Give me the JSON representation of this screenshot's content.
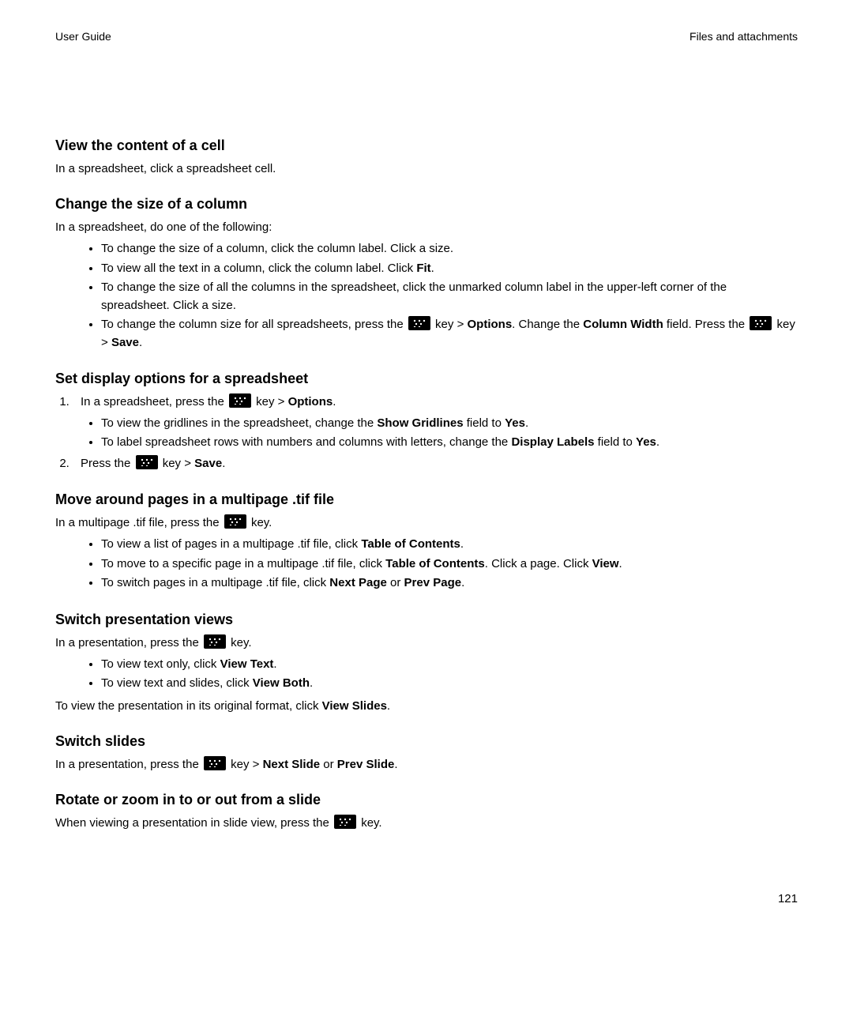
{
  "header": {
    "left": "User Guide",
    "right": "Files and attachments"
  },
  "page_number": "121",
  "sections": {
    "view_cell": {
      "title": "View the content of a cell",
      "p1": "In a spreadsheet, click a spreadsheet cell."
    },
    "change_col": {
      "title": "Change the size of a column",
      "intro": "In a spreadsheet, do one of the following:",
      "b1": "To change the size of a column, click the column label. Click a size.",
      "b2a": "To view all the text in a column, click the column label. Click ",
      "b2b": "Fit",
      "b2c": ".",
      "b3": "To change the size of all the columns in the spreadsheet, click the unmarked column label in the upper-left corner of the spreadsheet. Click a size.",
      "b4a": "To change the column size for all spreadsheets, press the ",
      "b4b": " key > ",
      "b4c": "Options",
      "b4d": ". Change the ",
      "b4e": "Column Width",
      "b4f": " field. Press the ",
      "b4g": " key > ",
      "b4h": "Save",
      "b4i": "."
    },
    "display_opts": {
      "title": "Set display options for a spreadsheet",
      "s1a": "In a spreadsheet, press the ",
      "s1b": " key > ",
      "s1c": "Options",
      "s1d": ".",
      "s1_b1a": "To view the gridlines in the spreadsheet, change the ",
      "s1_b1b": "Show Gridlines",
      "s1_b1c": " field to ",
      "s1_b1d": "Yes",
      "s1_b1e": ".",
      "s1_b2a": "To label spreadsheet rows with numbers and columns with letters, change the ",
      "s1_b2b": "Display Labels",
      "s1_b2c": " field to ",
      "s1_b2d": "Yes",
      "s1_b2e": ".",
      "s2a": "Press the ",
      "s2b": " key > ",
      "s2c": "Save",
      "s2d": "."
    },
    "tif": {
      "title": "Move around pages in a multipage .tif file",
      "introA": "In a multipage .tif file, press the ",
      "introB": " key.",
      "b1a": "To view a list of pages in a multipage .tif file, click ",
      "b1b": "Table of Contents",
      "b1c": ".",
      "b2a": "To move to a specific page in a multipage .tif file, click ",
      "b2b": "Table of Contents",
      "b2c": ". Click a page. Click ",
      "b2d": "View",
      "b2e": ".",
      "b3a": "To switch pages in a multipage .tif file, click ",
      "b3b": "Next Page",
      "b3c": " or ",
      "b3d": "Prev Page",
      "b3e": "."
    },
    "pres_views": {
      "title": "Switch presentation views",
      "introA": "In a presentation, press the ",
      "introB": " key.",
      "b1a": "To view text only, click ",
      "b1b": "View Text",
      "b1c": ".",
      "b2a": "To view text and slides, click ",
      "b2b": "View Both",
      "b2c": ".",
      "outA": "To view the presentation in its original format, click ",
      "outB": "View Slides",
      "outC": "."
    },
    "switch_slides": {
      "title": "Switch slides",
      "a": "In a presentation, press the ",
      "b": " key > ",
      "c": "Next Slide",
      "d": " or ",
      "e": "Prev Slide",
      "f": "."
    },
    "rotate": {
      "title": "Rotate or zoom in to or out from a slide",
      "a": "When viewing a presentation in slide view, press the ",
      "b": " key."
    }
  }
}
